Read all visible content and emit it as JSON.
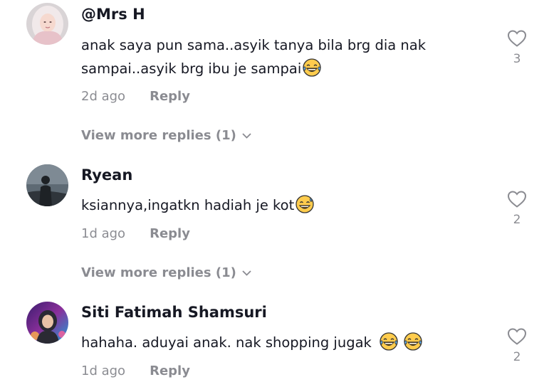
{
  "comments": [
    {
      "username": "@Mrs H",
      "text_line1": "anak saya pun sama..asyik tanya bila brg dia nak",
      "text_line2": "sampai..asyik brg ibu je sampai",
      "emoji": "face-with-tears-of-joy-icon",
      "time": "2d ago",
      "reply_label": "Reply",
      "view_more": "View more replies (1)",
      "like_count": "3"
    },
    {
      "username": "Ryean",
      "text_line1": "ksiannya,ingatkn hadiah je kot",
      "emoji": "grinning-face-with-sweat-icon",
      "time": "1d ago",
      "reply_label": "Reply",
      "view_more": "View more replies (1)",
      "like_count": "2"
    },
    {
      "username": "Siti Fatimah Shamsuri",
      "text_line1": "hahaha. aduyai anak. nak shopping jugak",
      "emoji": "face-with-tears-of-joy-icon",
      "time": "1d ago",
      "reply_label": "Reply",
      "like_count": "2"
    }
  ],
  "colors": {
    "primary_text": "#161823",
    "secondary_text": "rgba(22,24,35,0.5)",
    "emoji_yellow": "#FFCC4D",
    "emoji_tear": "#5DADEC"
  }
}
